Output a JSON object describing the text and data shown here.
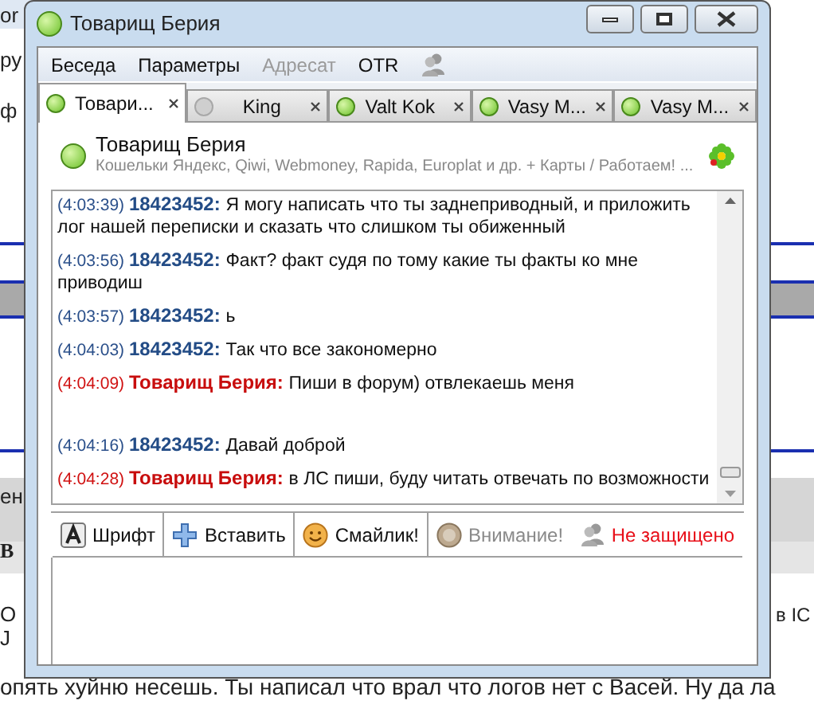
{
  "background": {
    "left_edge": [
      "or",
      "ру",
      "ф",
      "ен",
      "В",
      "О",
      "J"
    ],
    "right_edge": [
      "в IC"
    ],
    "line": "опять хуйню несешь. Ты написал что врал что логов нет с Васей. Ну да ла"
  },
  "window": {
    "title": "Товарищ Берия",
    "online": true
  },
  "menu": [
    {
      "label": "Беседа",
      "disabled": false
    },
    {
      "label": "Параметры",
      "disabled": false
    },
    {
      "label": "Адресат",
      "disabled": true
    },
    {
      "label": "OTR",
      "disabled": false
    }
  ],
  "tabs": [
    {
      "label": "Товари...",
      "online": true,
      "selected": true
    },
    {
      "label": "King",
      "online": false,
      "selected": false
    },
    {
      "label": "Valt Kok",
      "online": true,
      "selected": false
    },
    {
      "label": "Vasy M...",
      "online": true,
      "selected": false
    },
    {
      "label": "Vasy M...",
      "online": true,
      "selected": false
    }
  ],
  "contact": {
    "name": "Товарищ Берия",
    "status_text": "Кошельки Яндекс, Qiwi, Webmoney, Rapida, Europlat и др. + Карты / Работаем! ...",
    "online": true
  },
  "messages": [
    {
      "time": "(4:03:39)",
      "sender": "18423452:",
      "text": "Я могу написать что ты заднеприводный, и приложить лог нашей переписки и сказать что слишком ты обиженный",
      "kind": "outgoing"
    },
    {
      "time": "(4:03:56)",
      "sender": "18423452:",
      "text": "Факт? факт судя по тому какие ты факты ко мне приводиш",
      "kind": "outgoing"
    },
    {
      "time": "(4:03:57)",
      "sender": "18423452:",
      "text": "ь",
      "kind": "outgoing"
    },
    {
      "time": "(4:04:03)",
      "sender": "18423452:",
      "text": "Так что все закономерно",
      "kind": "outgoing"
    },
    {
      "time": "(4:04:09)",
      "sender": "Товарищ Берия:",
      "text": "Пиши в форум) отвлекаешь меня",
      "kind": "incoming"
    },
    {
      "time": "(4:04:16)",
      "sender": "18423452:",
      "text": "Давай доброй",
      "kind": "outgoing"
    },
    {
      "time": "(4:04:28)",
      "sender": "Товарищ Берия:",
      "text": "в ЛС пиши, буду читать отвечать по возможности",
      "kind": "incoming"
    }
  ],
  "toolbar": [
    {
      "label": "Шрифт",
      "kind": "font",
      "disabled": false
    },
    {
      "label": "Вставить",
      "kind": "insert",
      "disabled": false
    },
    {
      "label": "Смайлик!",
      "kind": "smiley",
      "disabled": false
    },
    {
      "label": "Внимание!",
      "kind": "attention",
      "disabled": true
    },
    {
      "label": "Не защищено",
      "kind": "security",
      "disabled": false
    }
  ]
}
